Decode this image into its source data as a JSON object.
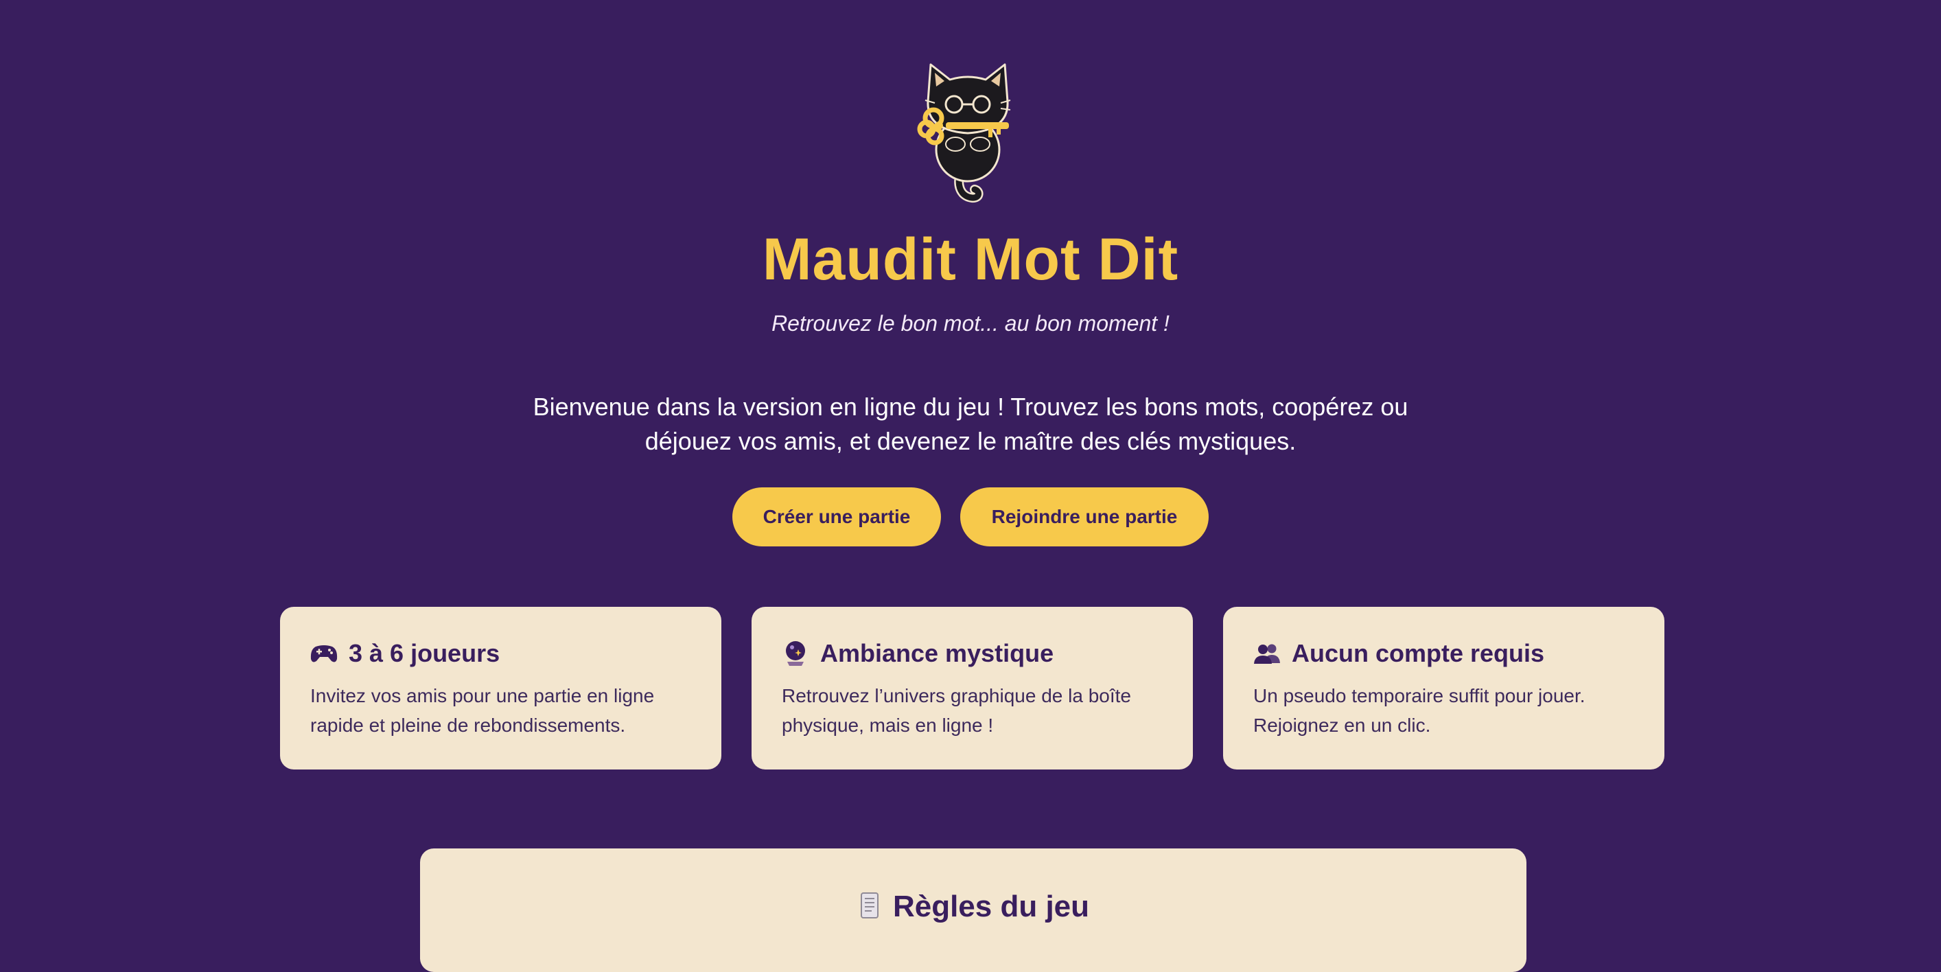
{
  "header": {
    "logo_icon": "black-cat-with-key-icon",
    "title": "Maudit Mot Dit",
    "subtitle": "Retrouvez le bon mot... au bon moment !"
  },
  "intro": {
    "text": "Bienvenue dans la version en ligne du jeu ! Trouvez les bons mots, coopérez ou déjouez vos amis, et devenez le maître des clés mystiques."
  },
  "actions": {
    "create_label": "Créer une partie",
    "join_label": "Rejoindre une partie"
  },
  "features": [
    {
      "icon": "game-controller-icon",
      "title": "3 à 6 joueurs",
      "text": "Invitez vos amis pour une partie en ligne rapide et pleine de rebondissements."
    },
    {
      "icon": "crystal-ball-icon",
      "title": "Ambiance mystique",
      "text": "Retrouvez l’univers graphique de la boîte physique, mais en ligne !"
    },
    {
      "icon": "people-icon",
      "title": "Aucun compte requis",
      "text": "Un pseudo temporaire suffit pour jouer. Rejoignez en un clic."
    }
  ],
  "rules": {
    "icon": "scroll-icon",
    "title": "Règles du jeu"
  },
  "colors": {
    "background": "#391e5e",
    "accent": "#f7c94b",
    "card": "#f3e6cf",
    "text_dark": "#391e5e"
  }
}
